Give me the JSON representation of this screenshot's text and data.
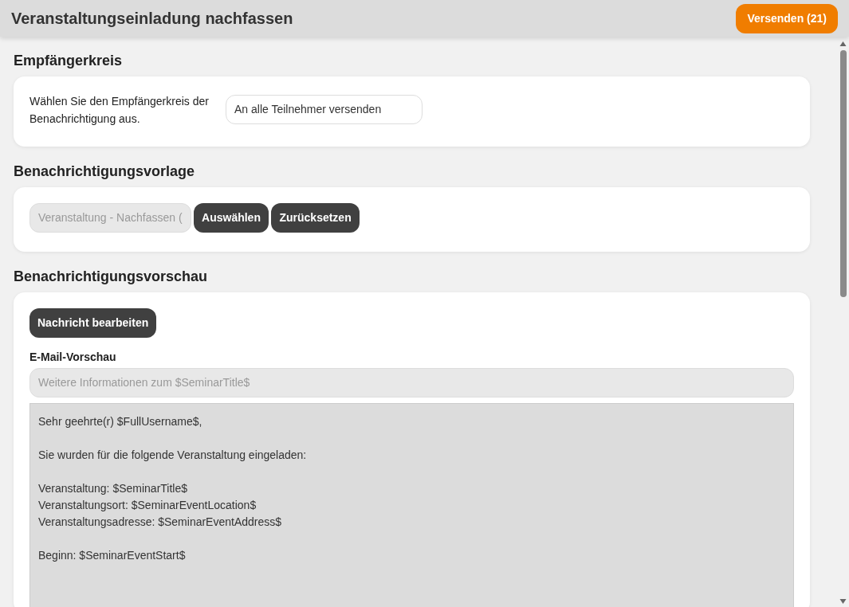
{
  "header": {
    "title": "Veranstaltungseinladung nachfassen",
    "send_button": "Versenden (21)"
  },
  "recipients": {
    "heading": "Empfängerkreis",
    "label": "Wählen Sie den Empfängerkreis der Benachrichtigung aus.",
    "select_value": "An alle Teilnehmer versenden"
  },
  "template": {
    "heading": "Benachrichtigungsvorlage",
    "field_value": "Veranstaltung - Nachfassen (",
    "field_disabled": true,
    "buttons": [
      "Auswählen",
      "Zurücksetzen"
    ]
  },
  "preview": {
    "heading": "Benachrichtigungsvorschau",
    "edit_button": "Nachricht bearbeiten",
    "email_label": "E-Mail-Vorschau",
    "subject_value": "Weitere Informationen zum $SeminarTitle$",
    "subject_disabled": true,
    "body_paragraphs": [
      [
        "Sehr geehrte(r) $FullUsername$,"
      ],
      [
        "Sie wurden für die folgende Veranstaltung eingeladen:"
      ],
      [
        "Veranstaltung: $SeminarTitle$",
        "Veranstaltungsort: $SeminarEventLocation$",
        "Veranstaltungsadresse: $SeminarEventAddress$"
      ],
      [
        "Beginn: $SeminarEventStart$"
      ]
    ]
  }
}
